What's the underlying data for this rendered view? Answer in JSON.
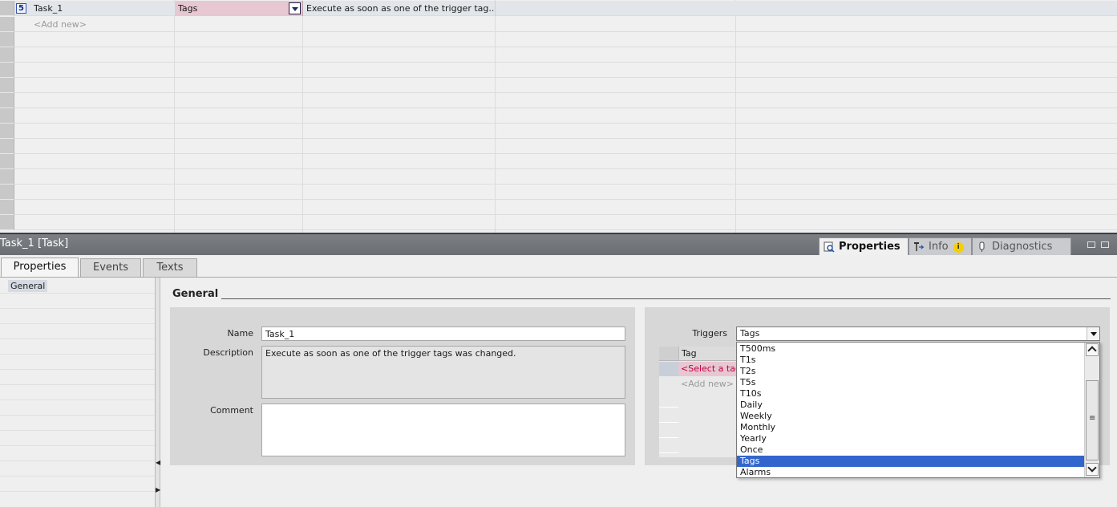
{
  "task_table": {
    "row_number": "5",
    "task_name": "Task_1",
    "trigger": "Tags",
    "description": "Execute as soon as one of the trigger tag...",
    "add_new": "<Add new>"
  },
  "inspector": {
    "title": "Task_1 [Task]",
    "tabs": [
      {
        "label": "Properties",
        "icon": "properties-icon"
      },
      {
        "label": "Info",
        "icon": "info-icon",
        "badge": "i"
      },
      {
        "label": "Diagnostics",
        "icon": "diagnostics-icon"
      }
    ],
    "sub_tabs": [
      "Properties",
      "Events",
      "Texts"
    ],
    "nav": {
      "general": "General"
    },
    "section_heading": "General"
  },
  "form": {
    "name_label": "Name",
    "name_value": "Task_1",
    "description_label": "Description",
    "description_value": "Execute as soon as one of the trigger tags was changed.",
    "comment_label": "Comment",
    "comment_value": ""
  },
  "triggers": {
    "label": "Triggers",
    "selected": "Tags",
    "tag_column": "Tag",
    "select_placeholder": "<Select a tag>",
    "add_new": "<Add new>",
    "options": [
      "T500ms",
      "T1s",
      "T2s",
      "T5s",
      "T10s",
      "Daily",
      "Weekly",
      "Monthly",
      "Yearly",
      "Once",
      "Tags",
      "Alarms"
    ],
    "highlighted_index": 10
  },
  "colors": {
    "selection": "#3366cc",
    "trigger_cell": "#e7c7d2",
    "inspector_bar": "#74777c"
  }
}
